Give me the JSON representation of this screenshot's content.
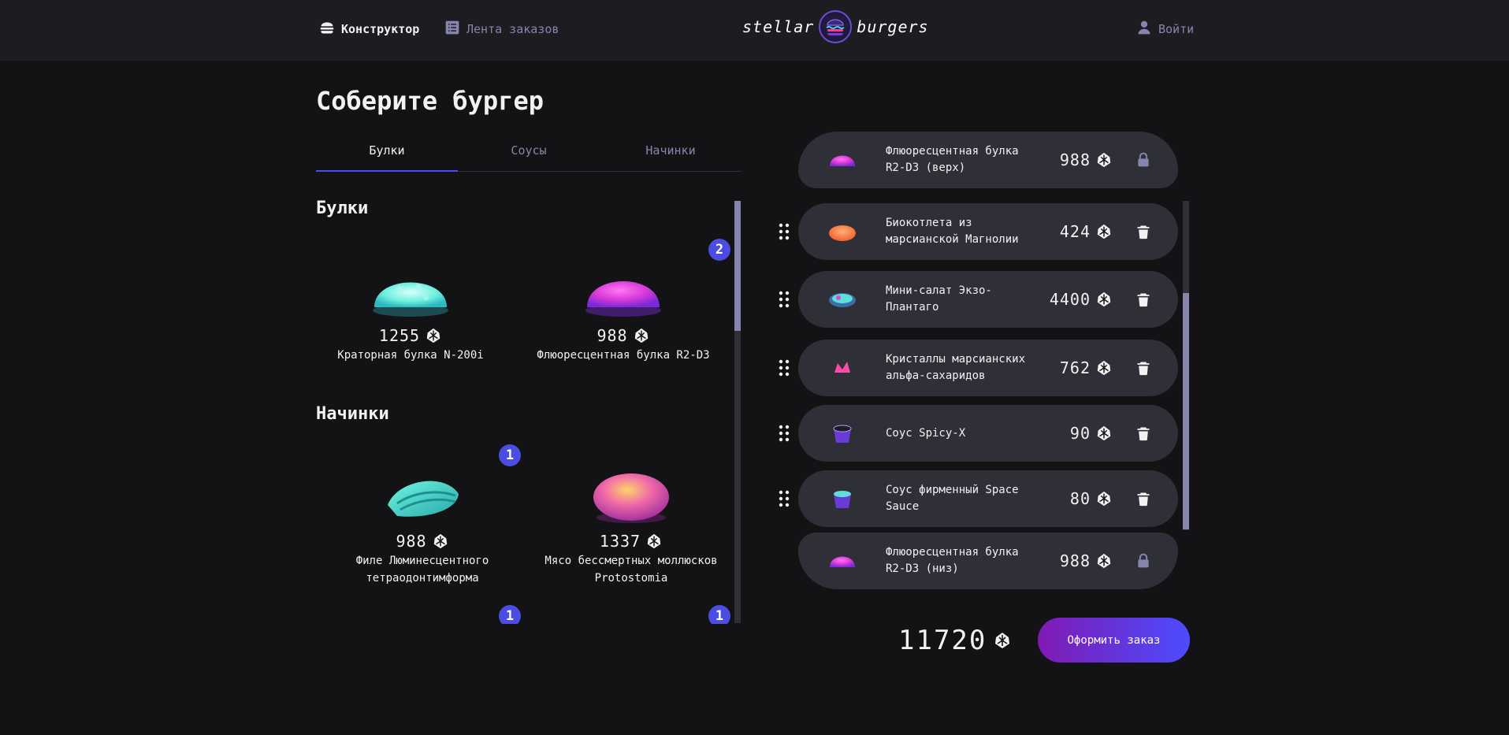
{
  "header": {
    "nav_constructor": "Конструктор",
    "nav_feed": "Лента заказов",
    "logo_left": "stellar",
    "logo_right": "burgers",
    "login": "Войти"
  },
  "colors": {
    "background": "#131316",
    "header_bg": "#1c1c21",
    "card_bg": "#2f2f37",
    "accent": "#4c4cff",
    "muted": "#8585ad",
    "button_gradient_from": "#801ab3",
    "button_gradient_to": "#4c4cff"
  },
  "icons": {
    "currency": "currency-icon",
    "burger": "burger-icon",
    "list": "list-icon",
    "profile": "profile-icon",
    "lock": "lock-icon",
    "trash": "trash-icon",
    "drag": "drag-handle-icon"
  },
  "page_title": "Соберите бургер",
  "tabs": [
    {
      "label": "Булки",
      "active": true
    },
    {
      "label": "Соусы",
      "active": false
    },
    {
      "label": "Начинки",
      "active": false
    }
  ],
  "sections": {
    "buns": {
      "title": "Булки",
      "items": [
        {
          "price": "1255",
          "name": "Краторная булка N-200i",
          "count": null
        },
        {
          "price": "988",
          "name": "Флюоресцентная булка R2-D3",
          "count": "2"
        }
      ]
    },
    "mains": {
      "title": "Начинки",
      "items": [
        {
          "price": "988",
          "name": "Филе Люминесцентного тетраодонтимформа",
          "count": "1"
        },
        {
          "price": "1337",
          "name": "Мясо бессмертных моллюсков Protostomia",
          "count": null
        }
      ],
      "partial_badges": [
        "1",
        "1"
      ]
    }
  },
  "constructor": {
    "top": {
      "name": "Флюоресцентная булка R2-D3 (верх)",
      "price": "988"
    },
    "items": [
      {
        "name": "Биокотлета из марсианской Магнолии",
        "price": "424"
      },
      {
        "name": "Мини-салат Экзо-Плантаго",
        "price": "4400"
      },
      {
        "name": "Кристаллы марсианских альфа-сахаридов",
        "price": "762"
      },
      {
        "name": "Соус Spicy-X",
        "price": "90"
      },
      {
        "name": "Соус фирменный Space Sauce",
        "price": "80"
      }
    ],
    "bottom": {
      "name": "Флюоресцентная булка R2-D3 (низ)",
      "price": "988"
    }
  },
  "total": "11720",
  "order_button": "Оформить заказ"
}
